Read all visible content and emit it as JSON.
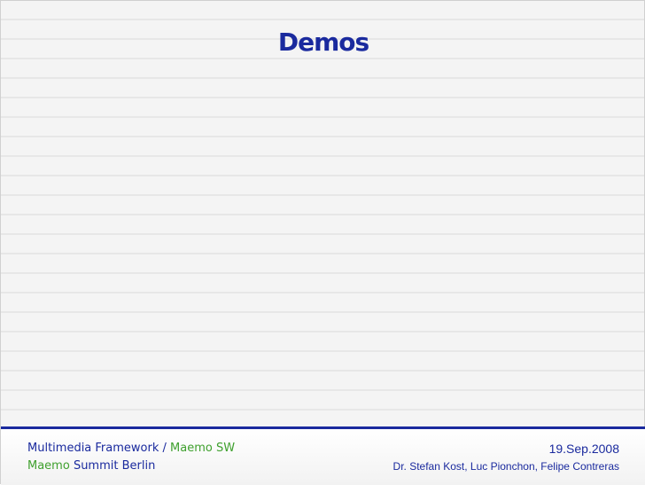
{
  "slide": {
    "title": "Demos"
  },
  "footer": {
    "framework": "Multimedia Framework",
    "separator": " / ",
    "team": "Maemo SW",
    "event_brand": "Maemo",
    "event_name": " Summit Berlin",
    "date": "19.Sep.2008",
    "authors": "Dr. Stefan Kost, Luc Pionchon, Felipe Contreras"
  },
  "colors": {
    "title_blue": "#1a2a9e",
    "accent_green": "#3fa02e",
    "footer_rule": "#1a2a9e"
  }
}
